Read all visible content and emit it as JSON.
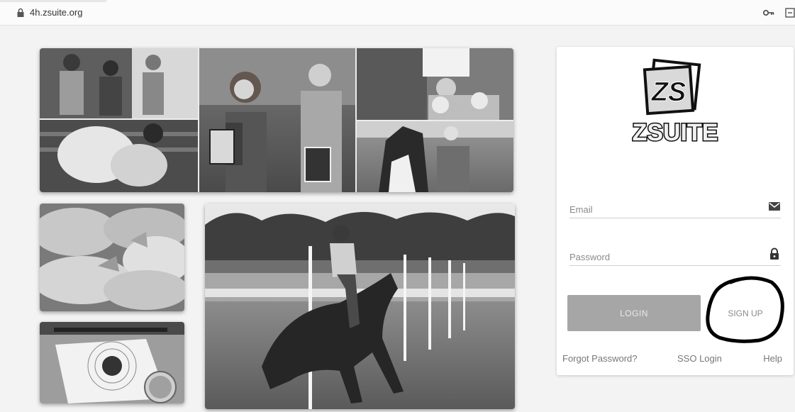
{
  "browser": {
    "url": "4h.zsuite.org"
  },
  "brand": {
    "logo_monogram": "ZS",
    "logo_wordmark": "ZSUITE"
  },
  "login": {
    "email_placeholder": "Email",
    "password_placeholder": "Password",
    "login_label": "LOGIN",
    "signup_label": "SIGN UP",
    "forgot_label": "Forgot Password?",
    "sso_label": "SSO Login",
    "help_label": "Help"
  },
  "icons": {
    "url_lock": "lock-icon",
    "key": "key-icon",
    "email": "envelope-icon",
    "password": "padlock-icon"
  },
  "colors": {
    "login_button": "#a6a6a6",
    "background": "#f3f3f3",
    "card": "#ffffff"
  }
}
